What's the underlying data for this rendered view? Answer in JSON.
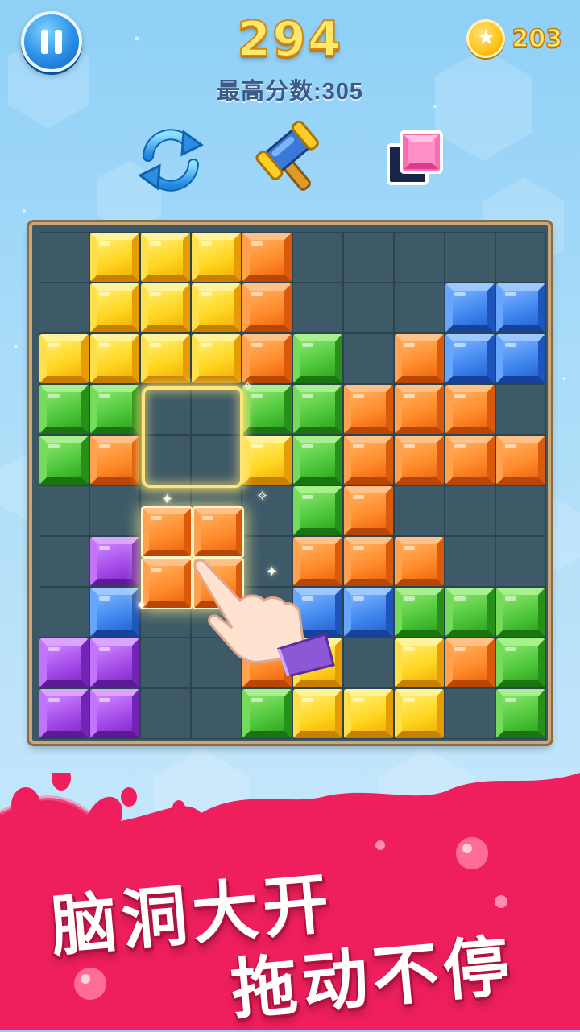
{
  "header": {
    "score": "294",
    "best_score_text": "最高分数:305",
    "coins": "203"
  },
  "tools": [
    {
      "name": "refresh",
      "icon": "refresh-icon"
    },
    {
      "name": "hammer",
      "icon": "hammer-icon"
    },
    {
      "name": "single-block",
      "icon": "single-block-icon"
    }
  ],
  "board": {
    "size": 10,
    "legend": {
      "Y": "yellow",
      "O": "orange",
      "G": "green",
      "B": "blue",
      "P": "purple",
      ".": "empty"
    },
    "rows": [
      ".YYYO.....",
      ".YYYO...BB",
      "YYYYOG.OBB",
      "GG..GGOOO.",
      "GO..YGOOOO",
      ".....GO...",
      ".P...OOO..",
      ".B...BBGGG",
      "PP..OY.YOG",
      "PP..GYYY.G"
    ],
    "target_slot": {
      "row": 3,
      "col": 2,
      "rows": 2,
      "cols": 2
    },
    "dragging_piece": {
      "color": "orange",
      "shape": "2x2"
    }
  },
  "banner": {
    "line1": "脑洞大开",
    "line2": "拖动不停",
    "color": "#ee1f5c"
  }
}
